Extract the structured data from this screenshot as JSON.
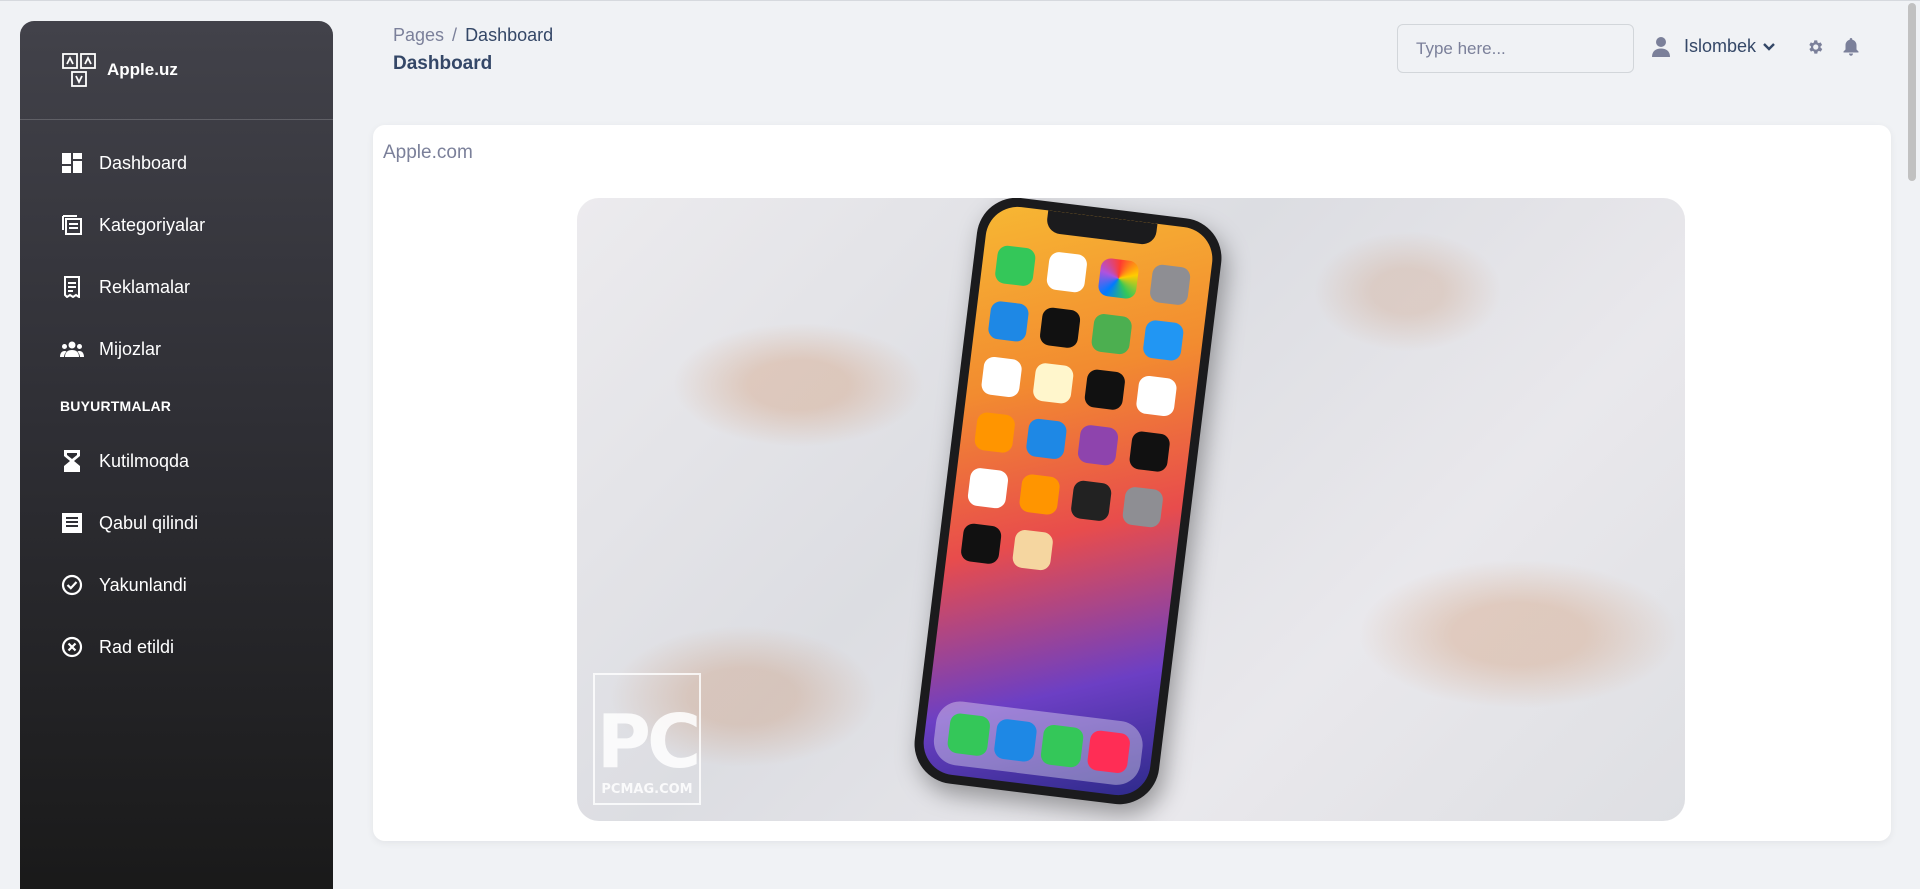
{
  "brand": {
    "name": "Apple.uz"
  },
  "sidebar": {
    "items": [
      {
        "label": "Dashboard",
        "icon": "dashboard-icon"
      },
      {
        "label": "Kategoriyalar",
        "icon": "categories-icon"
      },
      {
        "label": "Reklamalar",
        "icon": "receipt-icon"
      },
      {
        "label": "Mijozlar",
        "icon": "people-icon"
      }
    ],
    "section_title": "BUYURTMALAR",
    "order_items": [
      {
        "label": "Kutilmoqda",
        "icon": "hourglass-icon"
      },
      {
        "label": "Qabul qilindi",
        "icon": "list-icon"
      },
      {
        "label": "Yakunlandi",
        "icon": "check-circle-icon"
      },
      {
        "label": "Rad etildi",
        "icon": "x-circle-icon"
      }
    ]
  },
  "header": {
    "breadcrumb_root": "Pages",
    "breadcrumb_separator": "/",
    "breadcrumb_current": "Dashboard",
    "title": "Dashboard",
    "search_placeholder": "Type here...",
    "user_name": "Islombek"
  },
  "card": {
    "title": "Apple.com",
    "image_watermark_big": "PC",
    "image_watermark_small": "PCMAG.COM"
  },
  "colors": {
    "accent": "#344767",
    "muted": "#7b809a",
    "sidebar_top": "#42424a",
    "sidebar_bottom": "#191919"
  }
}
